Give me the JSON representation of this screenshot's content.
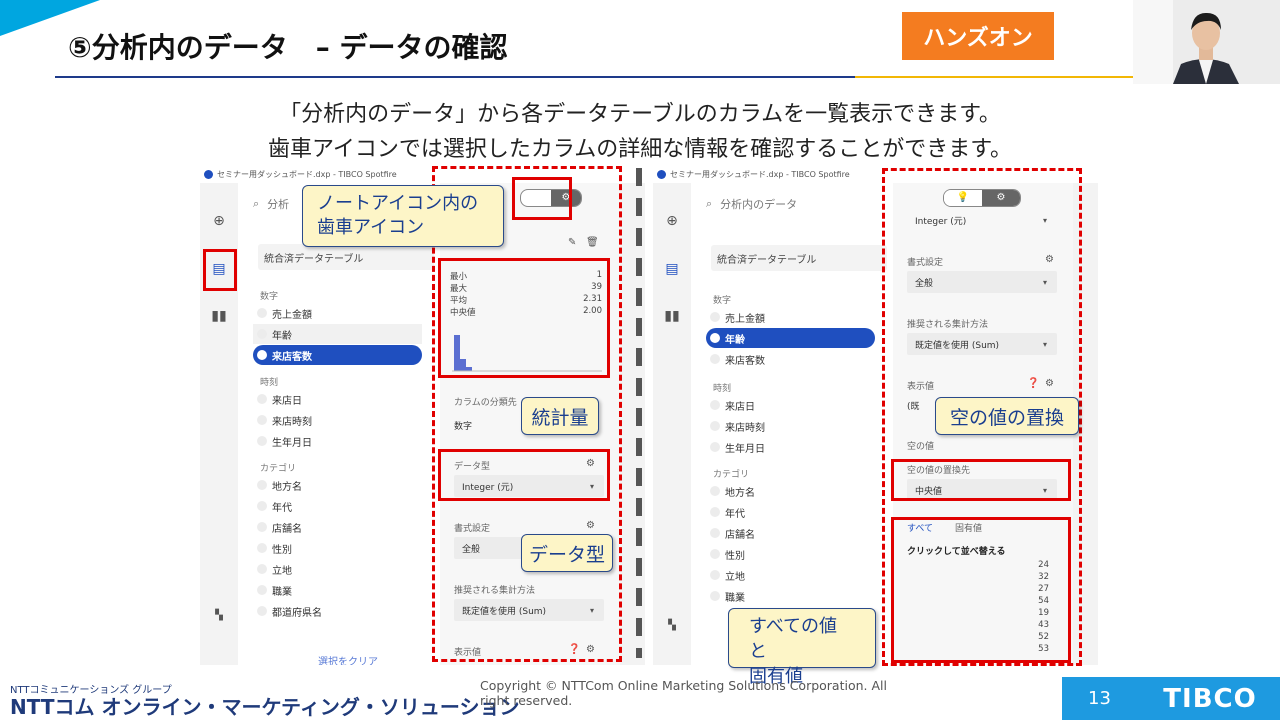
{
  "header": {
    "title": "⑤分析内のデータ　– データの確認",
    "badge": "ハンズオン"
  },
  "description": {
    "line1": "「分析内のデータ」から各データテーブルのカラムを一覧表示できます。",
    "line2": "歯車アイコンでは選択したカラムの詳細な情報を確認することができます。"
  },
  "left_app": {
    "titlebar": "セミナー用ダッシュボード.dxp - TIBCO Spotfire",
    "search": "分析",
    "table_name": "統合済データテーブル",
    "groups": [
      "数字",
      "時刻",
      "カテゴリ"
    ],
    "columns_num": [
      "売上金額",
      "年齢",
      "来店客数"
    ],
    "columns_time": [
      "来店日",
      "来店時刻",
      "生年月日"
    ],
    "columns_cat": [
      "地方名",
      "年代",
      "店舗名",
      "性別",
      "立地",
      "職業",
      "都道府県名"
    ],
    "clear_label": "選択をクリア",
    "stats": {
      "labels": [
        "最小",
        "最大",
        "平均",
        "中央値"
      ],
      "values": [
        "1",
        "39",
        "2.31",
        "2.00"
      ]
    },
    "category_label": "カラムの分類先",
    "category_value": "数字",
    "datatype_label": "データ型",
    "datatype_value": "Integer (元)",
    "format_label": "書式設定",
    "format_value": "全般",
    "agg_label": "推奨される集計方法",
    "agg_value": "既定値を使用 (Sum)",
    "display_label": "表示値"
  },
  "right_app": {
    "titlebar": "セミナー用ダッシュボード.dxp - TIBCO Spotfire",
    "search": "分析内のデータ",
    "table_name": "統合済データテーブル",
    "groups": [
      "数字",
      "時刻",
      "カテゴリ"
    ],
    "columns_num": [
      "売上金額",
      "年齢",
      "来店客数"
    ],
    "columns_time": [
      "来店日",
      "来店時刻",
      "生年月日"
    ],
    "columns_cat": [
      "地方名",
      "年代",
      "店舗名",
      "性別",
      "立地",
      "職業"
    ],
    "datatype_value": "Integer (元)",
    "format_label": "書式設定",
    "format_value": "全般",
    "agg_label": "推奨される集計方法",
    "agg_value": "既定値を使用 (Sum)",
    "display_label": "表示値",
    "display_value": "(既",
    "empty_label": "空の値",
    "replace_label": "空の値の置換先",
    "replace_value": "中央値",
    "tabs": [
      "すべて",
      "固有値"
    ],
    "sort_label": "クリックして並べ替える",
    "values": [
      "24",
      "32",
      "27",
      "54",
      "19",
      "43",
      "52",
      "53"
    ]
  },
  "callouts": {
    "gear": "ノートアイコン内の\n歯車アイコン",
    "stats": "統計量",
    "datatype": "データ型",
    "empty": "空の値の置換",
    "allvalues": "すべての値と\n固有値"
  },
  "footer": {
    "company_small": "NTTコミュニケーションズ グループ",
    "company": "NTTコム オンライン・マーケティング・ソリューション",
    "copyright": "Copyright © NTTCom Online Marketing Solutions Corporation. All right reserved.",
    "page": "13",
    "brand": "TIBCO"
  },
  "colors": {
    "accent_blue": "#1f4fbf",
    "badge_orange": "#f47c20",
    "highlight_red": "#e00000",
    "callout_fill": "#fdf5c7"
  }
}
